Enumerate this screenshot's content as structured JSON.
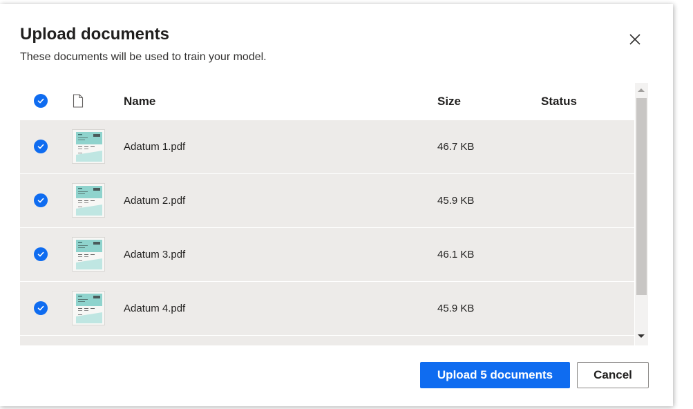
{
  "dialog": {
    "title": "Upload documents",
    "subtitle": "These documents will be used to train your model."
  },
  "icons": {
    "close": "close-icon",
    "header_file": "document-icon",
    "check": "checkmark-icon"
  },
  "colors": {
    "accent": "#0f6cf0",
    "row_bg": "#edebe9",
    "thumb_teal": "#8fd3cd"
  },
  "table": {
    "columns": {
      "name": "Name",
      "size": "Size",
      "status": "Status"
    },
    "rows": [
      {
        "name": "Adatum 1.pdf",
        "size": "46.7 KB",
        "status": "",
        "selected": true
      },
      {
        "name": "Adatum 2.pdf",
        "size": "45.9 KB",
        "status": "",
        "selected": true
      },
      {
        "name": "Adatum 3.pdf",
        "size": "46.1 KB",
        "status": "",
        "selected": true
      },
      {
        "name": "Adatum 4.pdf",
        "size": "45.9 KB",
        "status": "",
        "selected": true
      }
    ]
  },
  "footer": {
    "upload_label": "Upload 5 documents",
    "cancel_label": "Cancel"
  }
}
